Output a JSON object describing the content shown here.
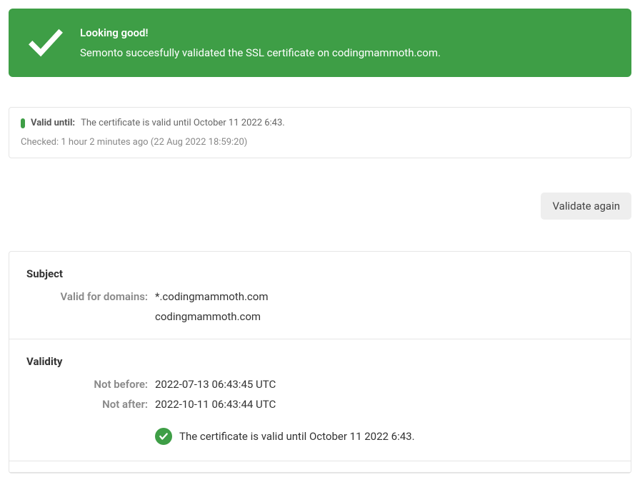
{
  "banner": {
    "title": "Looking good!",
    "body": "Semonto succesfully validated the SSL certificate on codingmammoth.com."
  },
  "info": {
    "valid_until_label": "Valid until:",
    "valid_until_value": "The certificate is valid until October 11 2022 6:43.",
    "checked": "Checked: 1 hour 2 minutes ago (22 Aug 2022 18:59:20)"
  },
  "actions": {
    "validate_again": "Validate again"
  },
  "details": {
    "subject": {
      "heading": "Subject",
      "valid_for_domains_label": "Valid for domains:",
      "domains": [
        "*.codingmammoth.com",
        "codingmammoth.com"
      ]
    },
    "validity": {
      "heading": "Validity",
      "not_before_label": "Not before:",
      "not_before_value": "2022-07-13 06:43:45 UTC",
      "not_after_label": "Not after:",
      "not_after_value": "2022-10-11 06:43:44 UTC",
      "valid_message": "The certificate is valid until October 11 2022 6:43."
    }
  }
}
